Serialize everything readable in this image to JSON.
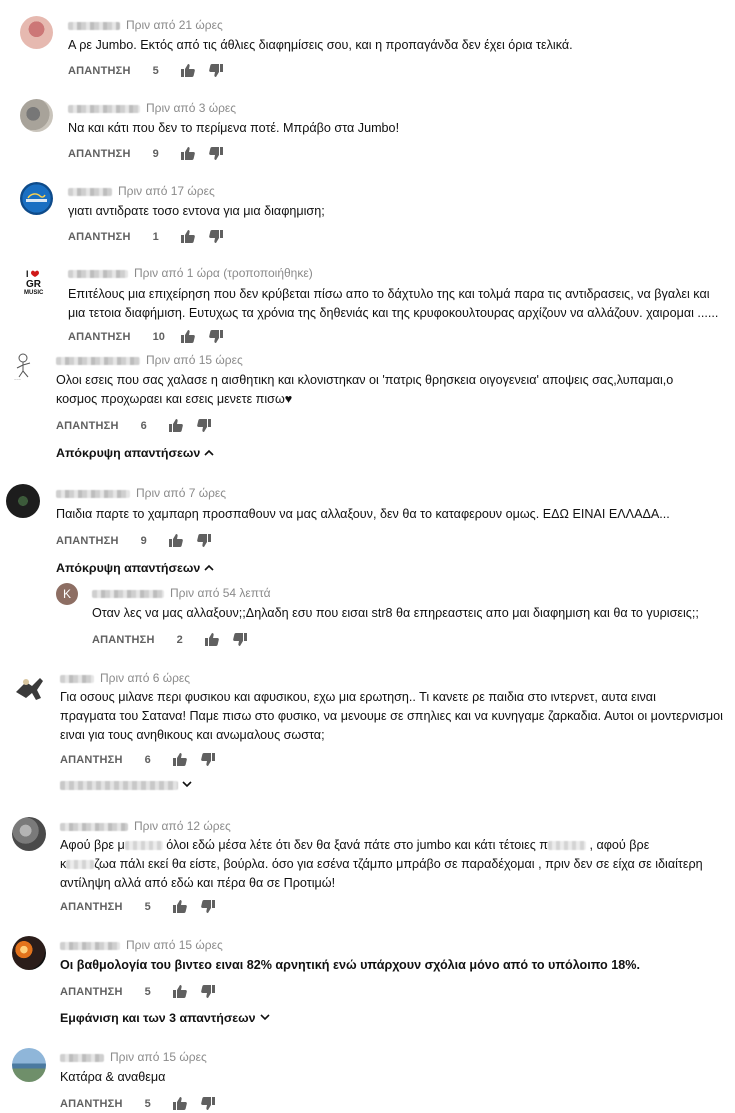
{
  "reply_label": "ΑΠΑΝΤΗΣΗ",
  "comments": [
    {
      "time": "Πριν από 21 ώρες",
      "text": "Α ρε Jumbo. Εκτός από τις άθλιες διαφημίσεις σου, και η προπαγάνδα δεν έχει όρια τελικά.",
      "likes": "5"
    },
    {
      "time": "Πριν από 3 ώρες",
      "text": "Να και κάτι που δεν το περίμενα ποτέ. Μπράβο στα Jumbo!",
      "likes": "9"
    },
    {
      "time": "Πριν από 17 ώρες",
      "text": "γιατι αντιδρατε τοσο εντονα για μια διαφημιση;",
      "likes": "1"
    },
    {
      "time": "Πριν από 1 ώρα (τροποποιήθηκε)",
      "text_line1": "Επιτέλους μια επιχείρηση που δεν κρύβεται πίσω απο το δάχτυλο της και τολμά παρα τις αντιδρασεις, να βγαλει και",
      "text_line2": "μια τετοια διαφήμιση. Ευτυχως τα χρόνια της δηθενιάς και της κρυφοκουλτουρας αρχίζουν να αλλάζουν. χαιρομαι ......",
      "likes": "10"
    },
    {
      "time": "Πριν από 15 ώρες",
      "text_line1": "Ολοι εσεις που σας χαλασε η αισθητικη και κλονιστηκαν οι 'πατρις θρησκεια οιγογενεια' αποψεις σας,λυπαμαι,ο",
      "text_line2": "κοσμος προχωραει και εσεις μενετε πισω♥",
      "likes": "6",
      "toggle": "Απόκρυψη απαντήσεων"
    },
    {
      "time": "Πριν από 7 ώρες",
      "text": "Παιδια παρτε το χαμπαρη προσπαθουν να μας αλλαξουν, δεν θα το καταφερουν ομως. ΕΔΩ ΕΙΝΑΙ ΕΛΛΑΔΑ...",
      "likes": "9",
      "toggle": "Απόκρυψη απαντήσεων"
    },
    {
      "time": "Πριν από 54 λεπτά",
      "avatar_letter": "K",
      "text": "Οταν λες να μας αλλαξουν;;Δηλαδη εσυ που εισαι str8 θα επηρεαστεις απο μαι διαφημιση και θα το γυρισεις;;",
      "likes": "2"
    },
    {
      "time": "Πριν από 6 ώρες",
      "text_line1": "Για οσους μιλανε περι φυσικου και αφυσικου, εχω μια ερωτηση.. Τι κανετε ρε παιδια στο ιντερνετ, αυτα ειναι",
      "text_line2": "πραγματα του Σατανα! Παμε πισω στο φυσικο, να μενουμε σε σπηλιες και να κυνηγαμε ζαρκαδια. Αυτοι οι μοντερνισμοι",
      "text_line3": "ειναι για τους ανηθικους και ανωμαλους σωστα;",
      "likes": "6"
    },
    {
      "time": "Πριν από 12 ώρες",
      "line1_a": "Αφού βρε μ",
      "line1_b": " όλοι εδώ μέσα λέτε ότι δεν θα ξανά πάτε στο jumbo και κάτι τέτοιες π",
      "line1_c": " , αφού βρε",
      "line2_a": "κ",
      "line2_b": "ζωα πάλι εκεί θα είστε, βούρλα. όσο για εσένα τζάμπο μπράβο σε παραδέχομαι , πριν δεν σε είχα σε ιδιαίτερη",
      "line3": "αντίληψη αλλά από εδώ και πέρα θα σε Προτιμώ!",
      "likes": "5"
    },
    {
      "time": "Πριν από 15 ώρες",
      "text": "Οι βαθμολογία του βιντεο ειναι 82% αρνητική ενώ υπάρχουν σχόλια μόνο από το υπόλοιπο 18%.",
      "likes": "5",
      "toggle": "Εμφάνιση και των 3 απαντήσεων"
    },
    {
      "time": "Πριν από 15 ώρες",
      "text": "Κατάρα & αναθεμα",
      "likes": "5"
    }
  ]
}
